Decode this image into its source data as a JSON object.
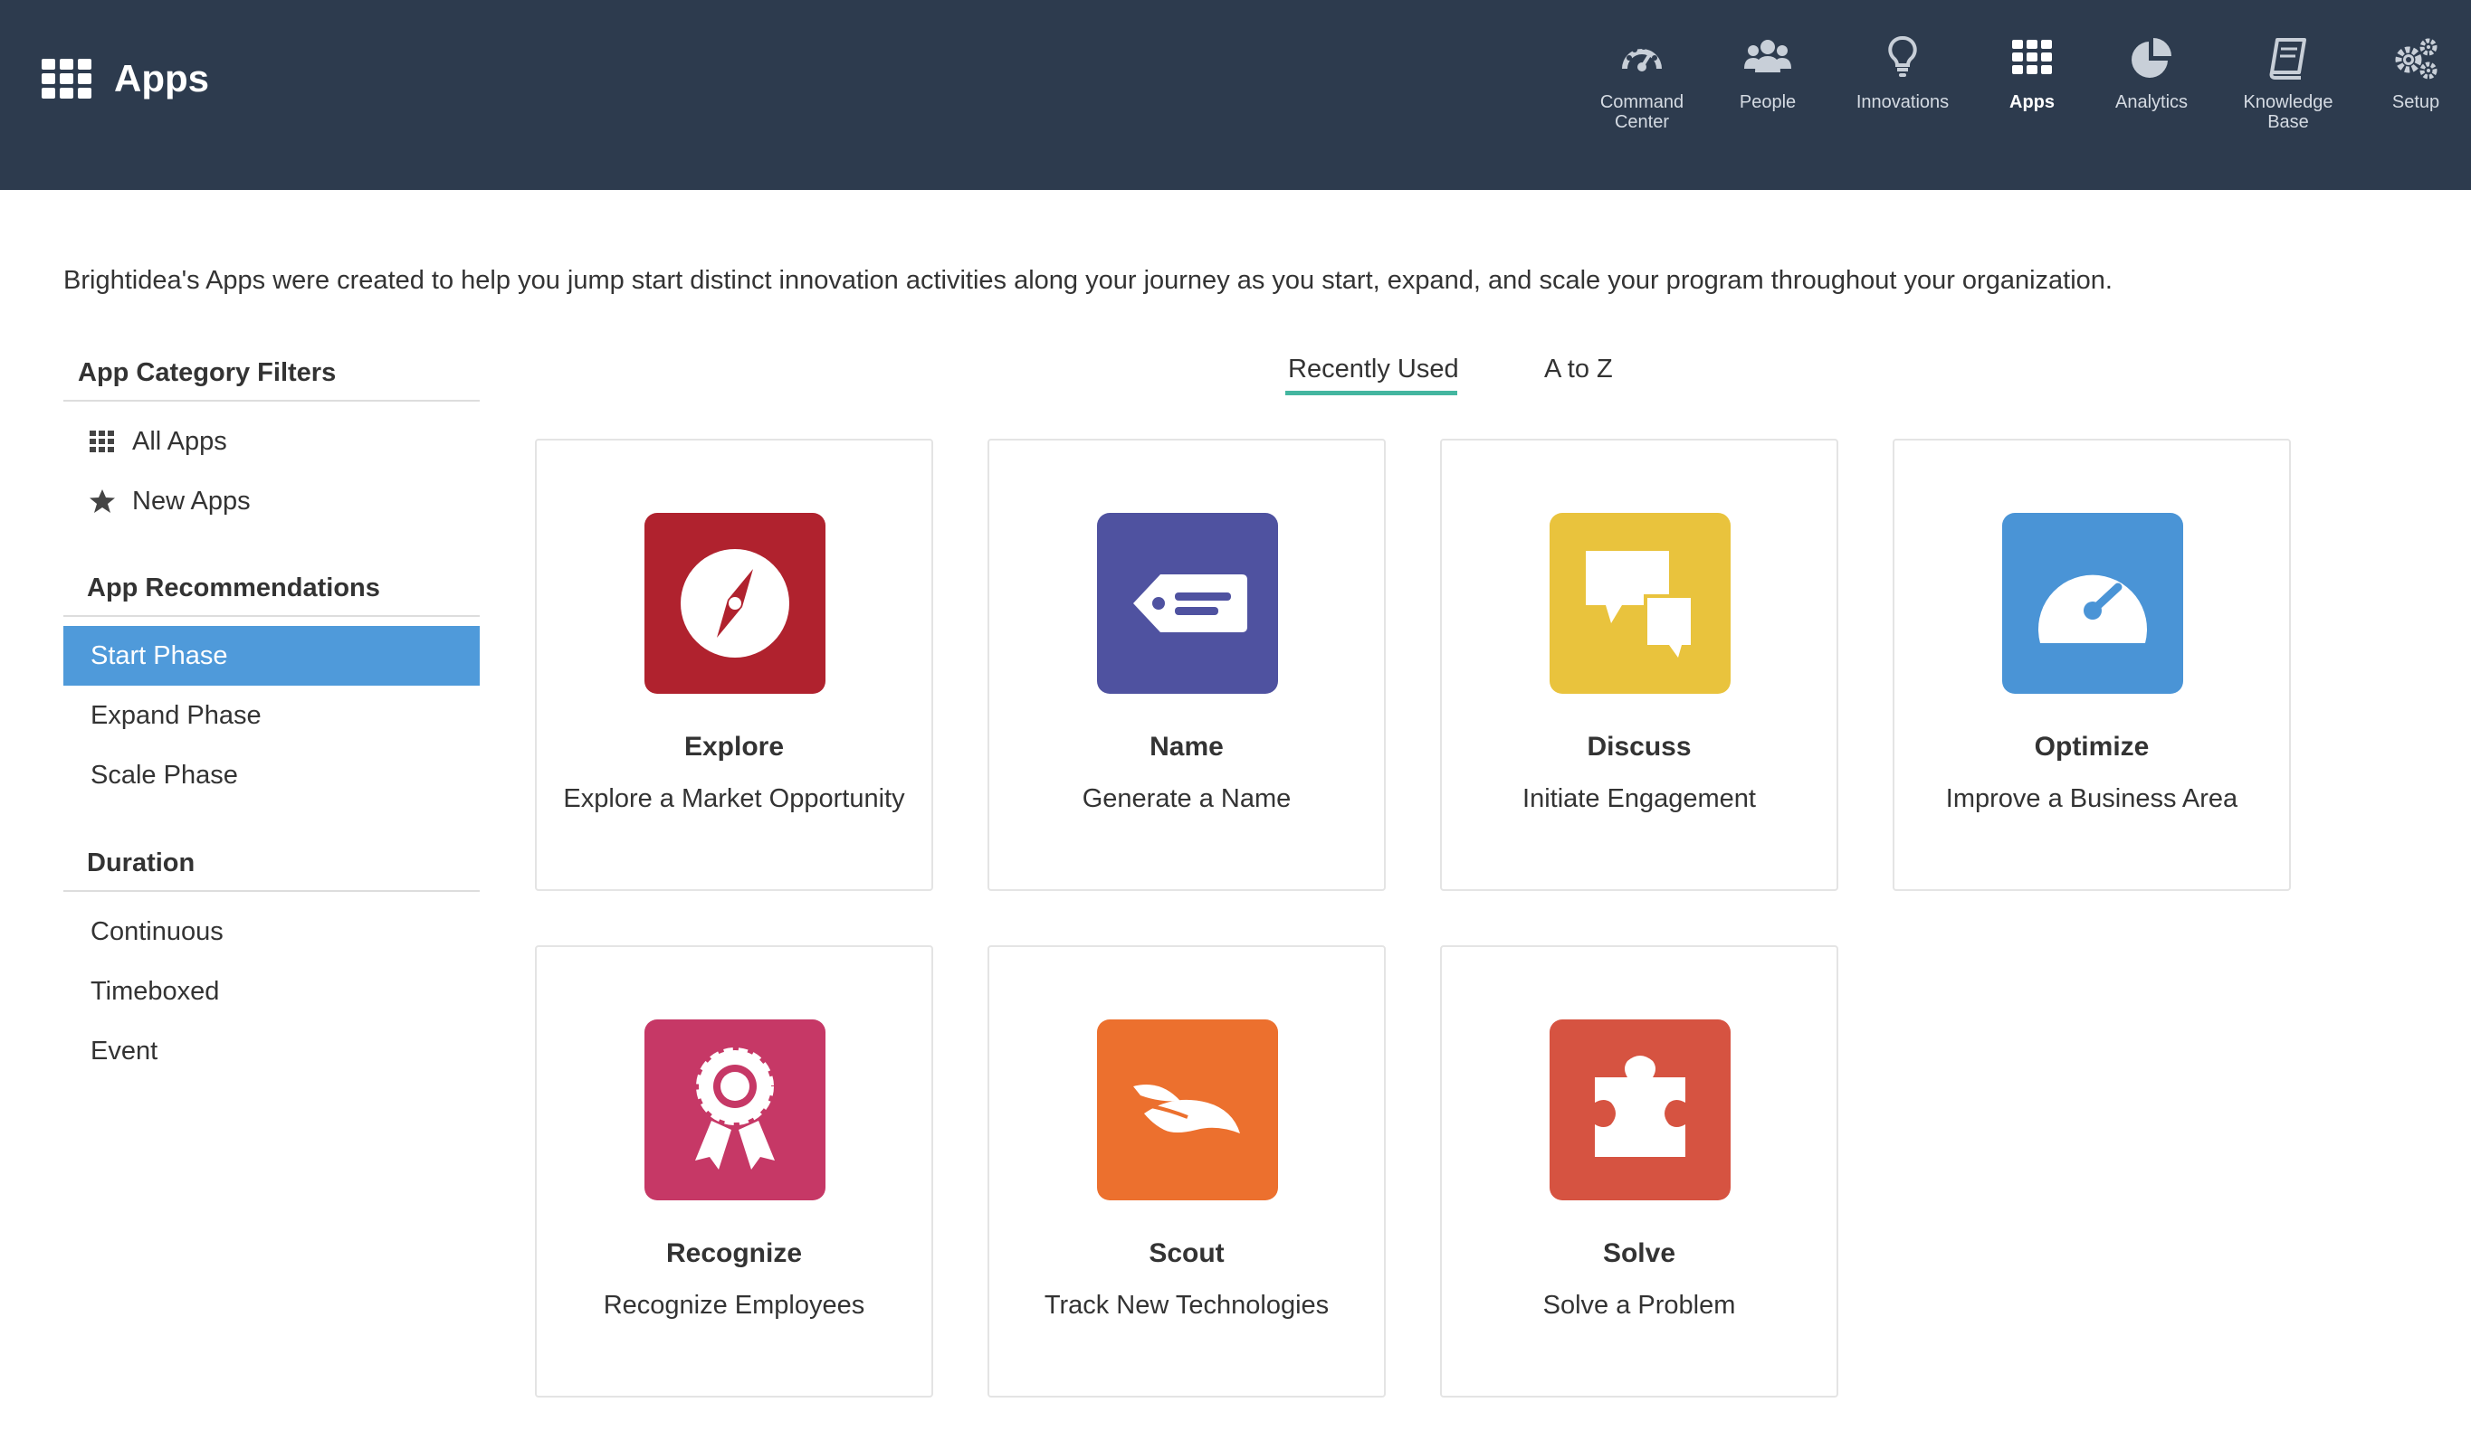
{
  "header": {
    "title": "Apps",
    "nav": [
      {
        "label": "Command Center",
        "icon": "dashboard-icon"
      },
      {
        "label": "People",
        "icon": "people-icon"
      },
      {
        "label": "Innovations",
        "icon": "lightbulb-icon"
      },
      {
        "label": "Apps",
        "icon": "apps-grid-icon",
        "active": true
      },
      {
        "label": "Analytics",
        "icon": "pie-chart-icon"
      },
      {
        "label": "Knowledge Base",
        "icon": "book-icon"
      },
      {
        "label": "Setup",
        "icon": "gears-icon"
      }
    ]
  },
  "intro": "Brightidea's Apps were created to help you jump start distinct innovation activities along your journey as you start, expand, and scale your program throughout your organization.",
  "sidebar": {
    "filters_heading": "App Category Filters",
    "filters": [
      {
        "label": "All Apps",
        "icon": "grid-icon"
      },
      {
        "label": "New Apps",
        "icon": "star-icon"
      }
    ],
    "recommendations_heading": "App Recommendations",
    "recommendations": [
      {
        "label": "Start Phase",
        "active": true
      },
      {
        "label": "Expand Phase"
      },
      {
        "label": "Scale Phase"
      }
    ],
    "duration_heading": "Duration",
    "durations": [
      {
        "label": "Continuous"
      },
      {
        "label": "Timeboxed"
      },
      {
        "label": "Event"
      }
    ]
  },
  "tabs": [
    {
      "label": "Recently Used",
      "active": true
    },
    {
      "label": "A to Z"
    }
  ],
  "apps": [
    {
      "name": "Explore",
      "desc": "Explore a Market Opportunity",
      "color": "#b0222e",
      "icon": "compass-icon"
    },
    {
      "name": "Name",
      "desc": "Generate a Name",
      "color": "#4f52a0",
      "icon": "tag-icon"
    },
    {
      "name": "Discuss",
      "desc": "Initiate Engagement",
      "color": "#e9c33d",
      "icon": "chat-bubbles-icon"
    },
    {
      "name": "Optimize",
      "desc": "Improve a Business Area",
      "color": "#4a94d6",
      "icon": "gauge-icon"
    },
    {
      "name": "Recognize",
      "desc": "Recognize Employees",
      "color": "#c63866",
      "icon": "award-ribbon-icon"
    },
    {
      "name": "Scout",
      "desc": "Track New Technologies",
      "color": "#ec702e",
      "icon": "feathered-hat-icon"
    },
    {
      "name": "Solve",
      "desc": "Solve a Problem",
      "color": "#d65341",
      "icon": "puzzle-piece-icon"
    }
  ]
}
